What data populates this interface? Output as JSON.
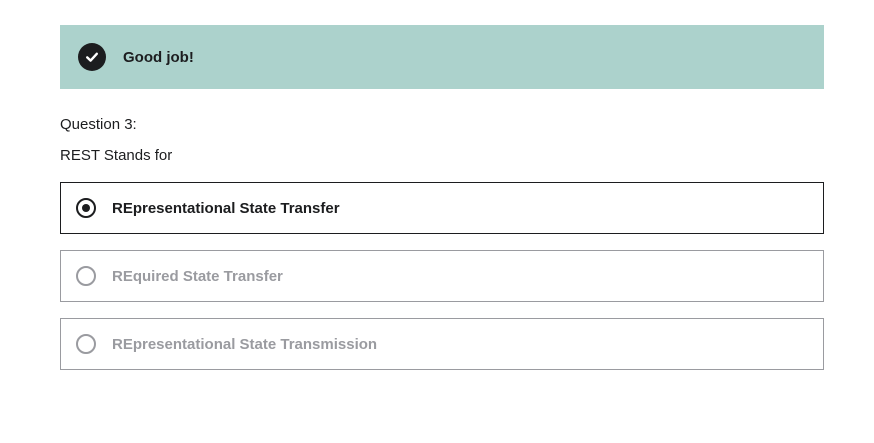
{
  "alert": {
    "icon": "check-circle-icon",
    "message": "Good job!",
    "background": "#acd2cc"
  },
  "question": {
    "number_label": "Question 3:",
    "prompt": "REST Stands for",
    "options": [
      {
        "label": "REpresentational State Transfer",
        "selected": true
      },
      {
        "label": "REquired State Transfer",
        "selected": false
      },
      {
        "label": "REpresentational State Transmission",
        "selected": false
      }
    ]
  }
}
